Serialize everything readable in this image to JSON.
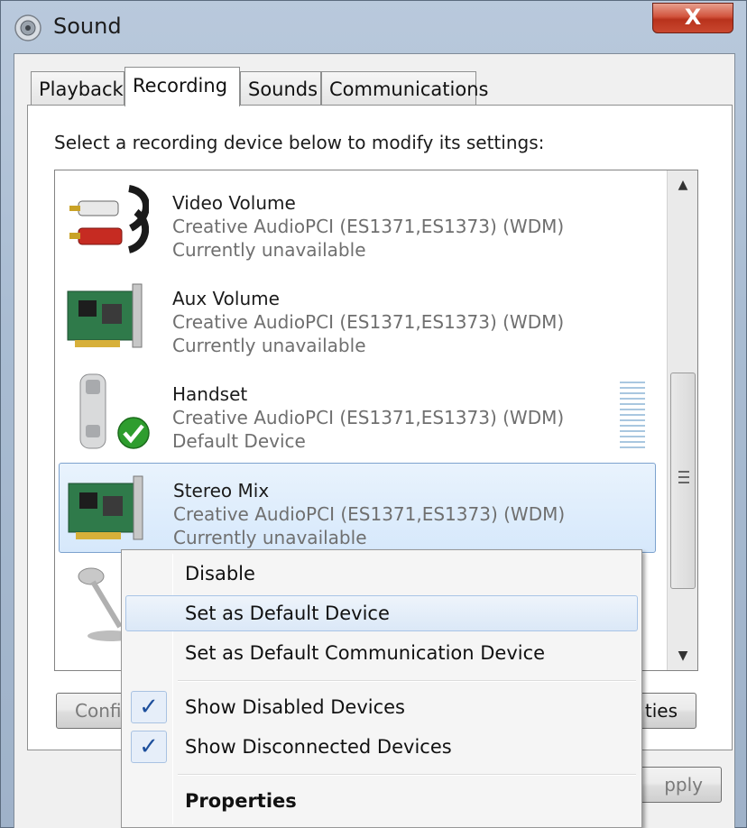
{
  "window": {
    "title": "Sound",
    "close_glyph": "X"
  },
  "tabs": [
    {
      "label": "Playback"
    },
    {
      "label": "Recording"
    },
    {
      "label": "Sounds"
    },
    {
      "label": "Communications"
    }
  ],
  "instruction": "Select a recording device below to modify its settings:",
  "devices": [
    {
      "name": "Video Volume",
      "driver": "Creative AudioPCI (ES1371,ES1373) (WDM)",
      "status": "Currently unavailable",
      "icon": "rca-cable-icon"
    },
    {
      "name": "Aux Volume",
      "driver": "Creative AudioPCI (ES1371,ES1373) (WDM)",
      "status": "Currently unavailable",
      "icon": "sound-card-icon"
    },
    {
      "name": "Handset",
      "driver": "Creative AudioPCI (ES1371,ES1373) (WDM)",
      "status": "Default Device",
      "icon": "handset-icon",
      "default": true
    },
    {
      "name": "Stereo Mix",
      "driver": "Creative AudioPCI (ES1371,ES1373) (WDM)",
      "status": "Currently unavailable",
      "icon": "sound-card-icon",
      "selected": true
    }
  ],
  "buttons": {
    "configure": "Confi",
    "properties": "ties",
    "apply": "pply"
  },
  "context_menu": {
    "items": [
      {
        "label": "Disable"
      },
      {
        "label": "Set as Default Device",
        "highlighted": true
      },
      {
        "label": "Set as Default Communication Device"
      },
      {
        "label": "Show Disabled Devices",
        "checked": true
      },
      {
        "label": "Show Disconnected Devices",
        "checked": true
      },
      {
        "label": "Properties",
        "bold": true
      }
    ],
    "check_glyph": "✓"
  },
  "colors": {
    "selection": "#d6e8fb",
    "close_button": "#c9472f",
    "default_check": "#2e9d2e"
  }
}
